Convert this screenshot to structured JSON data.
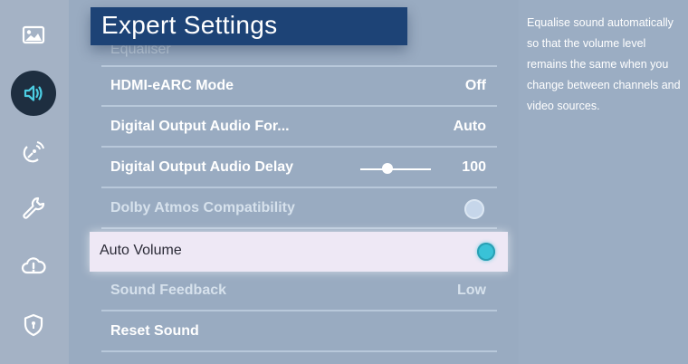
{
  "header": {
    "title": "Expert Settings"
  },
  "settings": {
    "equaliser": {
      "label": "Equaliser"
    },
    "hdmi_earc": {
      "label": "HDMI-eARC Mode",
      "value": "Off"
    },
    "digital_output_format": {
      "label": "Digital Output Audio For...",
      "value": "Auto"
    },
    "digital_output_delay": {
      "label": "Digital Output Audio Delay",
      "value": "100",
      "level": 0.38
    },
    "dolby_atmos": {
      "label": "Dolby Atmos Compatibility",
      "enabled": false
    },
    "auto_volume": {
      "label": "Auto Volume",
      "enabled": true
    },
    "sound_feedback": {
      "label": "Sound Feedback",
      "value": "Low"
    },
    "reset_sound": {
      "label": "Reset Sound"
    }
  },
  "help": {
    "text": "Equalise sound automatically so that the volume level remains the same when you change between channels and video sources."
  },
  "colors": {
    "accent": "#39c2d7",
    "title_bar": "#1d4376",
    "active_nav": "#1e2e40"
  },
  "sidebar": {
    "items": [
      {
        "icon": "picture-icon"
      },
      {
        "icon": "sound-icon",
        "active": true
      },
      {
        "icon": "broadcasting-icon"
      },
      {
        "icon": "general-icon"
      },
      {
        "icon": "support-icon"
      },
      {
        "icon": "privacy-icon"
      }
    ]
  }
}
